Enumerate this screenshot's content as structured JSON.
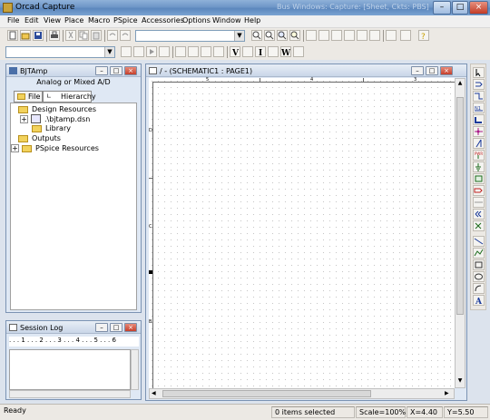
{
  "window": {
    "title": "Orcad Capture",
    "ghost_text": "Bus Windows: Capture: [Sheet, Ckts: PBS]"
  },
  "menu": [
    "File",
    "Edit",
    "View",
    "Place",
    "Macro",
    "PSpice",
    "Accessories",
    "Options",
    "Window",
    "Help"
  ],
  "toolbar": {
    "part_combo_value": "",
    "net_combo_value": ""
  },
  "project_window": {
    "title": "BJTAmp",
    "design_type": "Analog or Mixed A/D",
    "tabs": [
      "File",
      "Hierarchy"
    ],
    "tree": {
      "design_resources": "Design Resources",
      "dsn_file": ".\\bjtamp.dsn",
      "library": "Library",
      "outputs": "Outputs",
      "pspice_resources": "PSpice Resources"
    }
  },
  "session_log": {
    "title": "Session Log",
    "ruler": ". . . 1 . . . 2 . . . 3 . . . 4 . . . 5 . . . 6"
  },
  "schematic_window": {
    "title": "/ - (SCHEMATIC1 : PAGE1)",
    "top_ruler": [
      "5",
      "4",
      "3"
    ],
    "left_ruler": [
      "D",
      "C",
      "B"
    ]
  },
  "palette_icons": [
    "select-icon",
    "place-part-icon",
    "place-wire-icon",
    "place-net-alias-icon",
    "place-bus-icon",
    "place-junction-icon",
    "place-bus-entry-icon",
    "place-power-icon",
    "place-ground-icon",
    "place-hierarchical-block-icon",
    "place-port-icon",
    "place-pin-icon",
    "off-page-connector-icon",
    "place-no-connect-icon",
    "place-line-icon",
    "place-polyline-icon",
    "place-rectangle-icon",
    "place-ellipse-icon",
    "place-arc-icon",
    "place-text-icon"
  ],
  "status": {
    "ready": "Ready",
    "items_selected": "0 items selected",
    "scale": "Scale=100%",
    "x": "X=4.40",
    "y": "Y=5.50"
  },
  "colors": {
    "title_bar": "#6f97c8",
    "window_bg": "#dce3ed",
    "canvas": "#ffffff"
  }
}
